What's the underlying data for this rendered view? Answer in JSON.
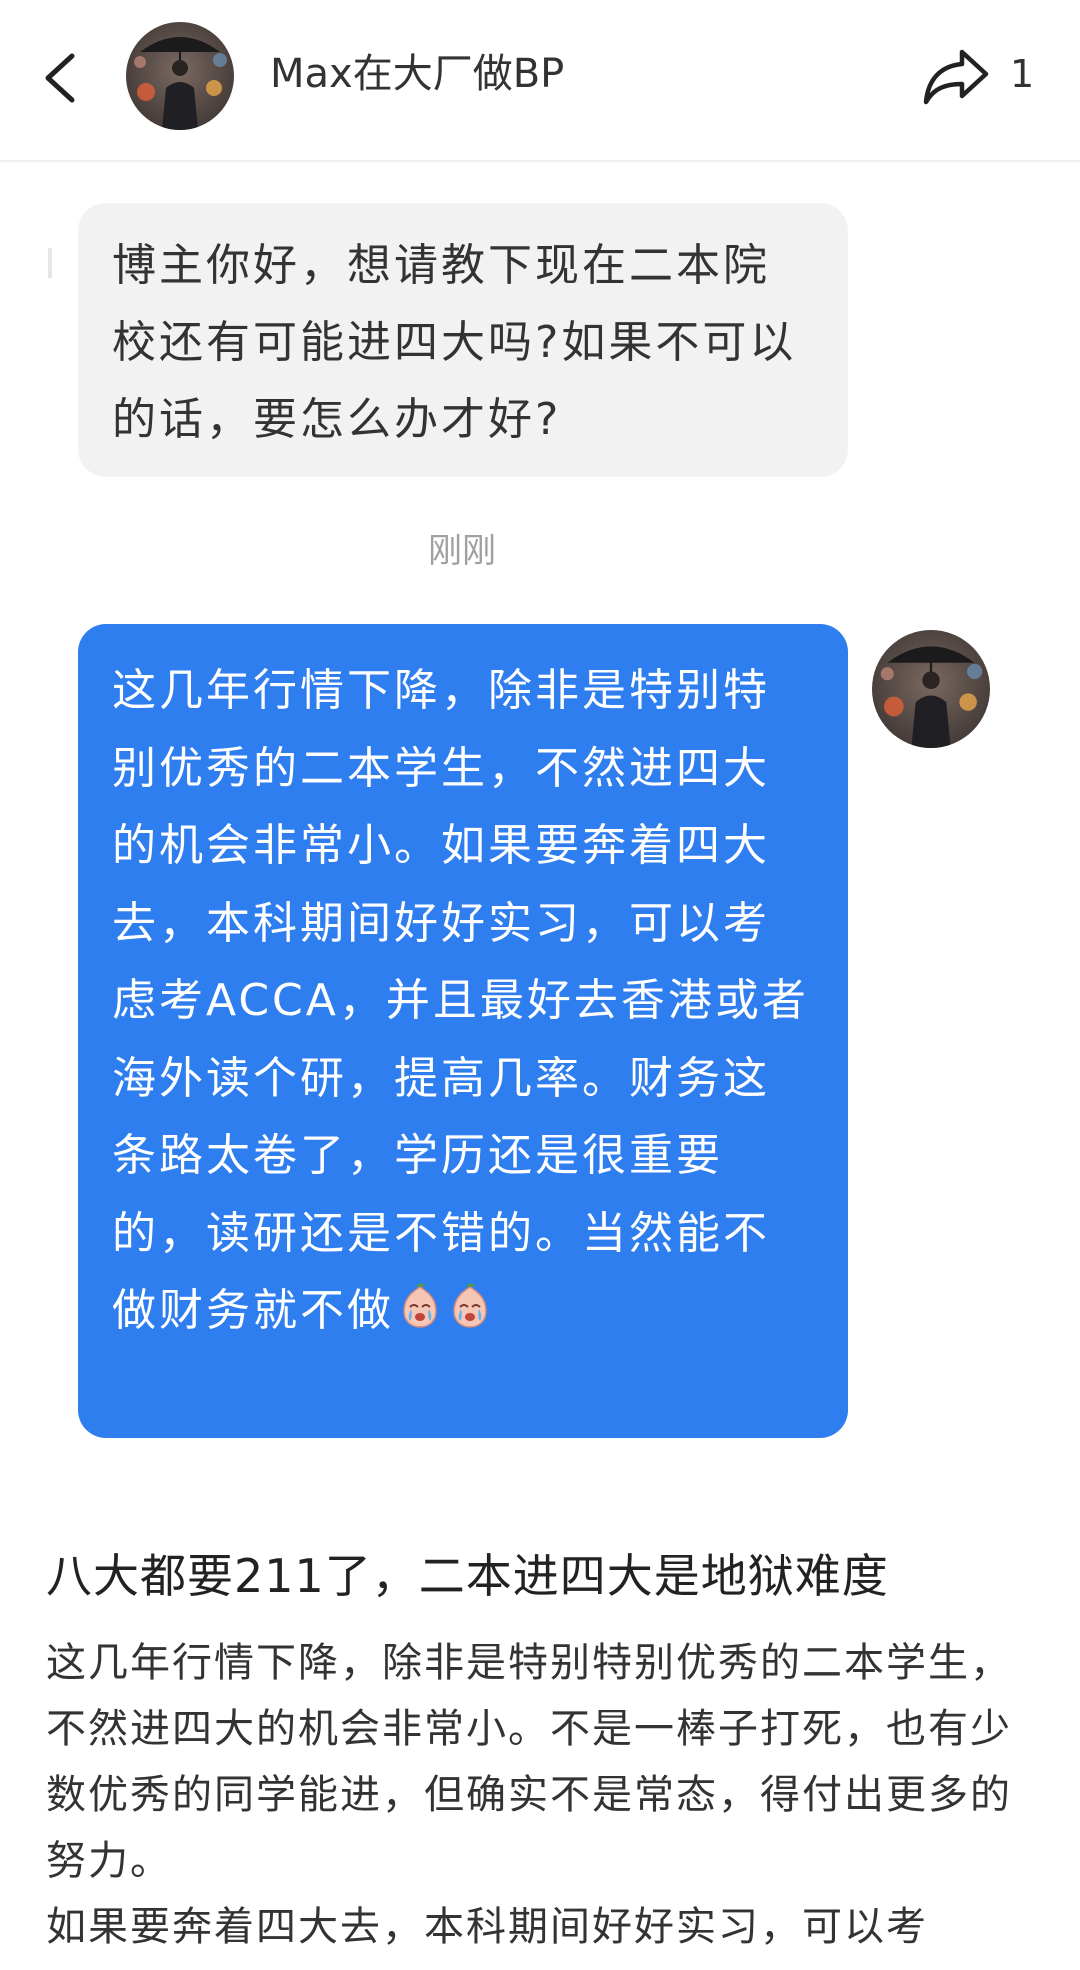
{
  "header": {
    "title": "Max在大厂做BP",
    "share_count": "1",
    "icons": {
      "back": "chevron-left-icon",
      "share": "share-arrow-icon"
    }
  },
  "messages": {
    "received": {
      "text": "博主你好，想请教下现在二本院校还有可能进四大吗?如果不可以的话，要怎么办才好?"
    },
    "timestamp": "刚刚",
    "sent": {
      "text": "这几年行情下降，除非是特别特别优秀的二本学生，不然进四大的机会非常小。如果要奔着四大去，本科期间好好实习，可以考虑考ACCA，并且最好去香港或者海外读个研，提高几率。财务这条路太卷了，学历还是很重要的，读研还是不错的。当然能不做财务就不做",
      "emojis": [
        "crying-face-emoji",
        "crying-face-emoji"
      ]
    }
  },
  "article": {
    "title": "八大都要211了，二本进四大是地狱难度",
    "paragraphs": [
      "这几年行情下降，除非是特别特别优秀的二本学生，不然进四大的机会非常小。不是一棒子打死，也有少数优秀的同学能进，但确实不是常态，得付出更多的努力。",
      "如果要奔着四大去，本科期间好好实习，可以考"
    ]
  },
  "colors": {
    "sent_bubble": "#2f7ef0",
    "received_bubble": "#f2f2f2",
    "timestamp": "#a0a0a0"
  }
}
